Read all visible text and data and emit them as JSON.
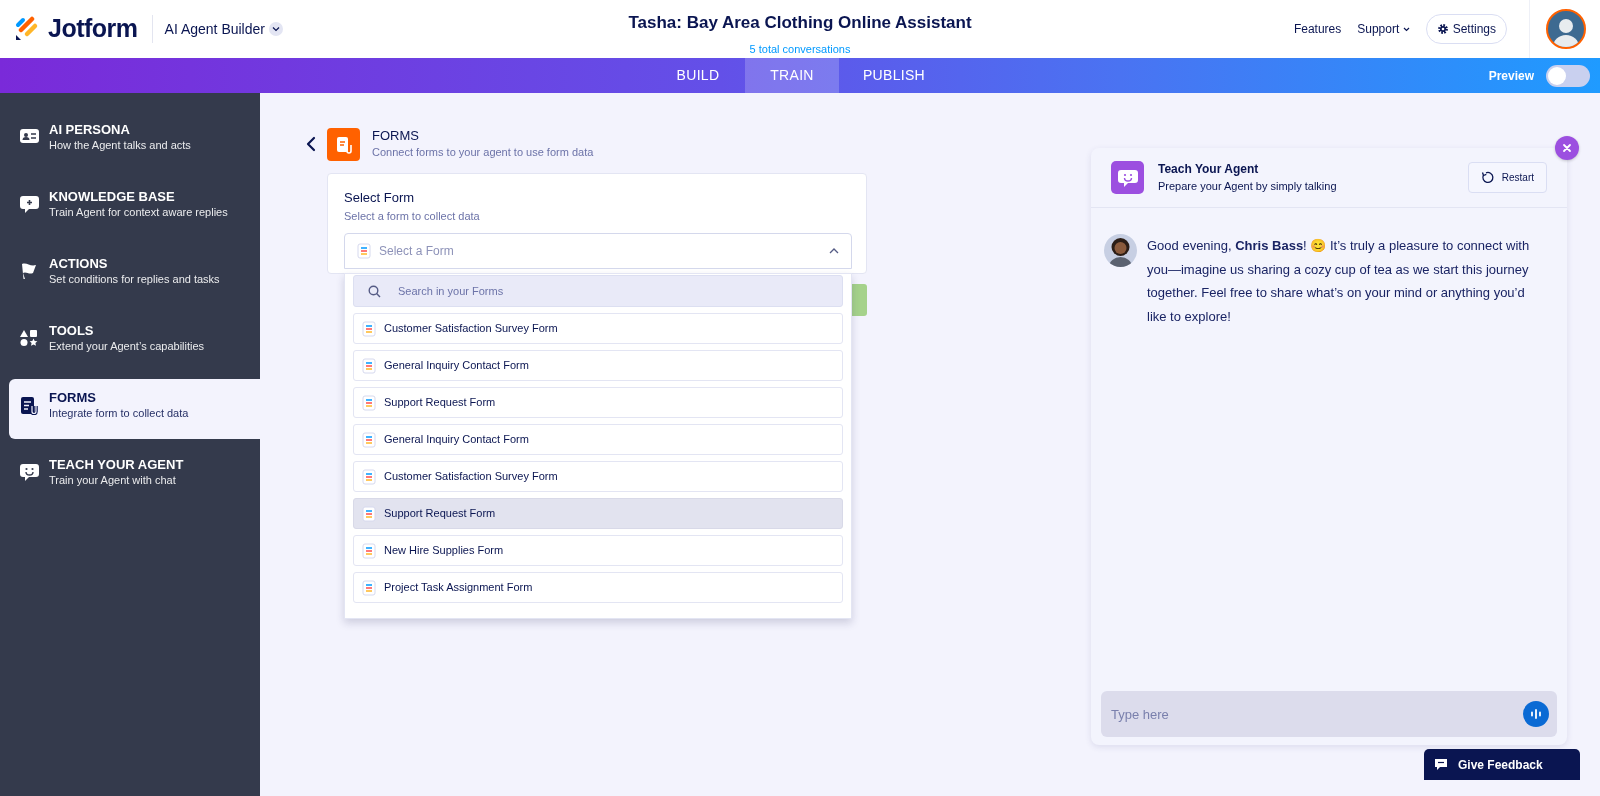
{
  "header": {
    "logo": "Jotform",
    "product": "AI Agent Builder",
    "title": "Tasha: Bay Area Clothing Online Assistant",
    "subtitle": "5 total conversations",
    "links": [
      "Features",
      "Support"
    ],
    "settings": "Settings"
  },
  "tabs": [
    {
      "label": "BUILD",
      "selected": false
    },
    {
      "label": "TRAIN",
      "selected": true
    },
    {
      "label": "PUBLISH",
      "selected": false
    }
  ],
  "preview": {
    "label": "Preview",
    "on": false
  },
  "sidebar": {
    "items": [
      {
        "title": "AI PERSONA",
        "subtitle": "How the Agent talks and acts",
        "selected": false
      },
      {
        "title": "KNOWLEDGE BASE",
        "subtitle": "Train Agent for context aware replies",
        "selected": false
      },
      {
        "title": "ACTIONS",
        "subtitle": "Set conditions for replies and tasks",
        "selected": false
      },
      {
        "title": "TOOLS",
        "subtitle": "Extend your Agent’s capabilities",
        "selected": false
      },
      {
        "title": "FORMS",
        "subtitle": "Integrate form to collect data",
        "selected": true
      },
      {
        "title": "TEACH YOUR AGENT",
        "subtitle": "Train your Agent with chat",
        "selected": false
      }
    ]
  },
  "section": {
    "title": "FORMS",
    "subtitle": "Connect forms to your agent to use form data"
  },
  "card": {
    "title": "Select Form",
    "subtitle": "Select a form to collect data",
    "select": {
      "placeholder": "Select a Form",
      "expanded": true
    },
    "search": {
      "placeholder": "Search in your Forms"
    },
    "options": [
      {
        "label": "Customer Satisfaction Survey Form",
        "selected": false
      },
      {
        "label": "General Inquiry Contact Form",
        "selected": false
      },
      {
        "label": "Support Request Form",
        "selected": false
      },
      {
        "label": "General Inquiry Contact Form",
        "selected": false
      },
      {
        "label": "Customer Satisfaction Survey Form",
        "selected": false
      },
      {
        "label": "Support Request Form",
        "selected": true
      },
      {
        "label": "New Hire Supplies Form",
        "selected": false
      },
      {
        "label": "Project Task Assignment Form",
        "selected": false
      }
    ]
  },
  "chat": {
    "title": "Teach Your Agent",
    "subtitle": "Prepare your Agent by simply talking",
    "restart": "Restart",
    "message": "Good evening, **Chris Bass**! 😊 It’s truly a pleasure to connect with you—imagine us sharing a cozy cup of tea as we start this journey together. Feel free to share what’s on your mind or anything you’d like to explore!",
    "input": {
      "placeholder": "Type here"
    }
  },
  "feedback": "Give Feedback"
}
